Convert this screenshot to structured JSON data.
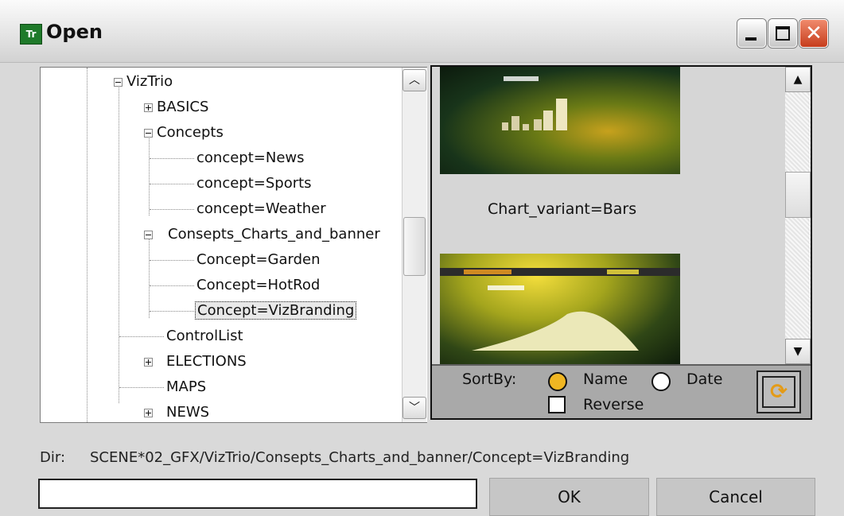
{
  "window": {
    "title": "Open",
    "app_icon_text": "Tr"
  },
  "titlebar_buttons": {
    "minimize": "minimize",
    "maximize": "maximize",
    "close": "✕"
  },
  "tree": {
    "items": [
      {
        "label": "VizTrio",
        "toggle": "-"
      },
      {
        "label": "BASICS",
        "toggle": "+"
      },
      {
        "label": "Concepts",
        "toggle": "-"
      },
      {
        "label": "concept=News"
      },
      {
        "label": "concept=Sports"
      },
      {
        "label": "concept=Weather"
      },
      {
        "label": "Consepts_Charts_and_banner",
        "toggle": "-"
      },
      {
        "label": "Concept=Garden"
      },
      {
        "label": "Concept=HotRod"
      },
      {
        "label": "Concept=VizBranding",
        "selected": true
      },
      {
        "label": "ControlList"
      },
      {
        "label": "ELECTIONS",
        "toggle": "+"
      },
      {
        "label": "MAPS"
      },
      {
        "label": "NEWS",
        "toggle": "+"
      }
    ]
  },
  "preview": {
    "caption": "Chart_variant=Bars",
    "sort": {
      "label": "SortBy:",
      "options": [
        "Name",
        "Date"
      ],
      "selected": "Name",
      "reverse_label": "Reverse",
      "reverse_checked": false
    }
  },
  "dir": {
    "label": "Dir:",
    "value": "SCENE*02_GFX/VizTrio/Consepts_Charts_and_banner/Concept=VizBranding"
  },
  "filename_value": "",
  "buttons": {
    "ok": "OK",
    "cancel": "Cancel"
  },
  "icons": {
    "refresh": "refresh-icon"
  }
}
